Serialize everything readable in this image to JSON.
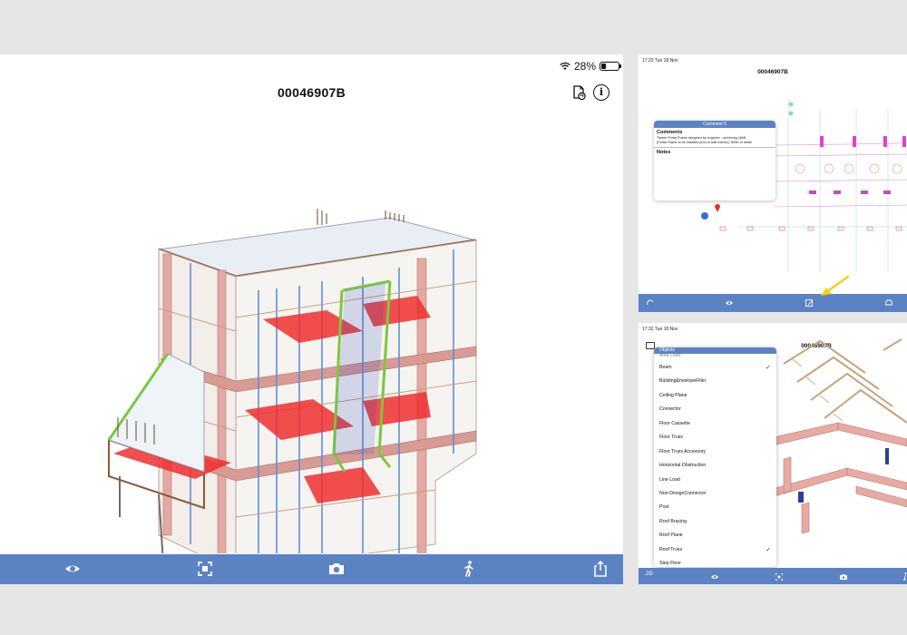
{
  "main": {
    "title": "00046907B",
    "status": {
      "battery": "28%",
      "battery_level": 0.28
    },
    "icons": {
      "document": "document-sync-icon",
      "info": "i",
      "toolbar": [
        "eye-icon",
        "focus-frame-icon",
        "camera-icon",
        "walk-icon",
        "share-icon"
      ]
    }
  },
  "thumb_top": {
    "status": "17:22  Tue 18 Nov",
    "title": "00046907B",
    "comment_panel": {
      "header": "Comment 5",
      "comments_label": "Comments",
      "comment_text_1": "Timber Portal Frame designed by engineer - achieving 18kN",
      "comment_text_2": "(Portal Frame to be installed prior to wall frames). Refer to detail",
      "notes_label": "Notes"
    }
  },
  "thumb_bottom": {
    "status": "17:32  Tue 18 Nov",
    "title": "00046907B",
    "objects_header": "Objects",
    "objects_partial": "Area Load",
    "objects": [
      {
        "label": "Beam",
        "checked": true
      },
      {
        "label": "BuildingEnvelopeFiller",
        "checked": false
      },
      {
        "label": "Ceiling Plane",
        "checked": false
      },
      {
        "label": "Connector",
        "checked": false
      },
      {
        "label": "Floor Cassette",
        "checked": false
      },
      {
        "label": "Floor Truss",
        "checked": false
      },
      {
        "label": "Floor Truss Accessory",
        "checked": false
      },
      {
        "label": "Horizontal Obstruction",
        "checked": false
      },
      {
        "label": "Line Load",
        "checked": false
      },
      {
        "label": "Non-DesignConnector",
        "checked": false
      },
      {
        "label": "Post",
        "checked": false
      },
      {
        "label": "Roof Bracing",
        "checked": false
      },
      {
        "label": "Roof Plane",
        "checked": false
      },
      {
        "label": "Roof Truss",
        "checked": true
      },
      {
        "label": "Step Floor",
        "checked": false
      }
    ],
    "check_glyph": "✓",
    "toolbar_label": "2D"
  },
  "colors": {
    "toolbar": "#5b83c4",
    "panel_header": "#5b83c4",
    "annotation_arrow": "#f2d016"
  }
}
